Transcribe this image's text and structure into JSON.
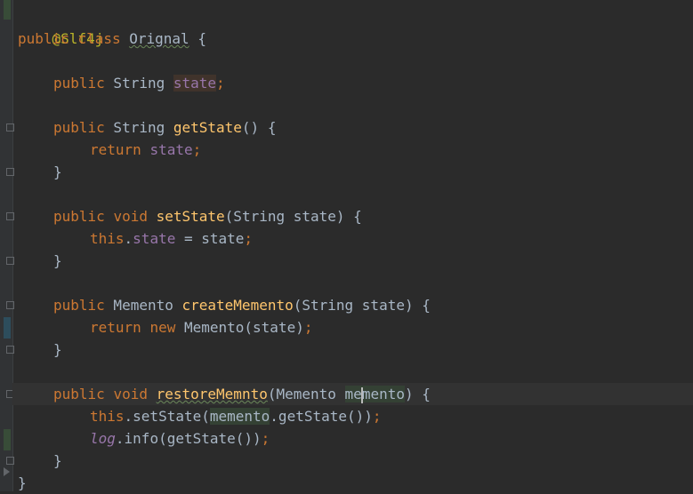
{
  "code": {
    "l1": "@Slf4j",
    "l2_kw1": "public",
    "l2_kw2": "class",
    "l2_name": "Orignal",
    "l2_rest": " {",
    "l4_kw": "public",
    "l4_type": " String ",
    "l4_field": "state",
    "l4_semi": ";",
    "l6_kw": "public",
    "l6_type": " String ",
    "l6_fn": "getState",
    "l6_rest": "() {",
    "l7_kw": "return",
    "l7_field": "state",
    "l7_semi": ";",
    "l8": "}",
    "l10_kw1": "public",
    "l10_kw2": "void",
    "l10_fn": "setState",
    "l10_rest": "(String state) {",
    "l11_kw": "this",
    "l11_dot": ".",
    "l11_field": "state",
    "l11_rest": " = state",
    "l11_semi": ";",
    "l12": "}",
    "l14_kw": "public",
    "l14_type": " Memento ",
    "l14_fn": "createMemento",
    "l14_rest": "(String state) {",
    "l15_kw1": "return",
    "l15_kw2": "new",
    "l15_rest": " Memento(state)",
    "l15_semi": ";",
    "l16": "}",
    "l18_kw1": "public",
    "l18_kw2": "void",
    "l18_fn": "restoreMemnto",
    "l18_open": "(Memento ",
    "l18_param_a": "me",
    "l18_param_b": "mento",
    "l18_close": ") {",
    "l19_kw": "this",
    "l19_a": ".setState(",
    "l19_var": "memento",
    "l19_b": ".getState())",
    "l19_semi": ";",
    "l20_field": "log",
    "l20_rest": ".info(getState())",
    "l20_semi": ";",
    "l21": "}",
    "l22": "}"
  },
  "colors": {
    "background": "#2b2b2b",
    "keyword": "#cc7832",
    "method": "#ffc66d",
    "field": "#9876aa",
    "annotation": "#bbb529",
    "text": "#a9b7c6"
  }
}
